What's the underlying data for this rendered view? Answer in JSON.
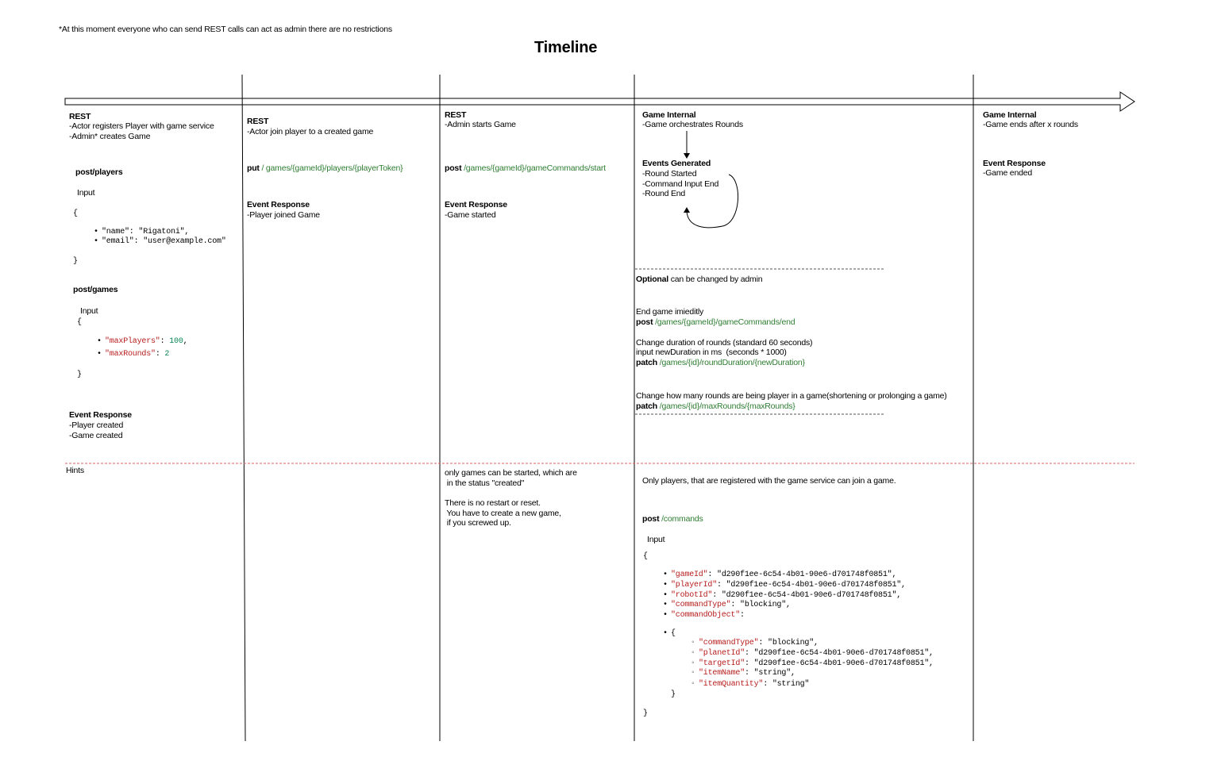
{
  "note": "*At this moment everyone who can send REST calls can act as admin there are no restrictions",
  "title": "Timeline",
  "col1": {
    "head": "REST",
    "l1": "-Actor registers Player with game service",
    "l2": "-Admin* creates Game",
    "ep1": "post/players",
    "input": "Input",
    "brace_open": "{",
    "brace_close": "}",
    "name_line": "\"name\": \"Rigatoni\",",
    "email_line": "\"email\": \"user@example.com\"",
    "ep2": "post/games",
    "k1": "\"maxPlayers\"",
    "v1": "100",
    "k2": "\"maxRounds\"",
    "v2": "2",
    "sep": ": ",
    "comma": ",",
    "er_head": "Event Response",
    "er1": "-Player created",
    "er2": "-Game created",
    "hints": "Hints"
  },
  "col2": {
    "head": "REST",
    "l1": "-Actor join player to a created game",
    "verb": "put",
    "path": " / games/{gameId}/players/{playerToken}",
    "er_head": "Event Response",
    "er1": "-Player joined Game"
  },
  "col3": {
    "head": "REST",
    "l1": "-Admin starts Game",
    "verb": "post",
    "path": " /games/{gameId}/gameCommands/start",
    "er_head": "Event Response",
    "er1": "-Game started",
    "h1": "only games can be started, which are",
    "h2": " in the status \"created\"",
    "h3": "There is no restart or reset.",
    "h4": " You have to create a new game,",
    "h5": " if you screwed up."
  },
  "col4": {
    "head": "Game Internal",
    "l1": "-Game orchestrates Rounds",
    "ev_head": "Events Generated",
    "ev1": "-Round Started",
    "ev2": "-Command Input End",
    "ev3": "-Round End",
    "opt_b": "Optional",
    "opt_t": " can be changed by admin",
    "end1": "End game imieditly",
    "end_verb": "post",
    "end_path": " /games/{gameId}/gameCommands/end",
    "dur1": "Change duration of rounds (standard 60 seconds)",
    "dur2": "input newDuration in ms  (seconds * 1000)",
    "dur_verb": "patch",
    "dur_path": " /games/{id}/roundDuration/{newDuration}",
    "mr1": "Change how many rounds are being player in a game(shortening or prolonging a game)",
    "mr_verb": "patch",
    "mr_path": " /games/{id}/maxRounds/{maxRounds}",
    "hint": "Only players, that are registered with the game service can join a game.",
    "cmd_verb": "post",
    "cmd_path": " /commands",
    "input": "Input",
    "brace_open": "{",
    "brace_close": "}",
    "f1k": "\"gameId\"",
    "f1v": ": \"d290f1ee-6c54-4b01-90e6-d701748f0851\",",
    "f2k": "\"playerId\"",
    "f2v": ": \"d290f1ee-6c54-4b01-90e6-d701748f0851\",",
    "f3k": "\"robotId\"",
    "f3v": ": \"d290f1ee-6c54-4b01-90e6-d701748f0851\",",
    "f4k": "\"commandType\"",
    "f4v": ": \"blocking\",",
    "f5k": "\"commandObject\"",
    "f5v": ":",
    "obj_open": "{",
    "obj_close": "}",
    "s1k": "\"commandType\"",
    "s1v": ": \"blocking\",",
    "s2k": "\"planetId\"",
    "s2v": ": \"d290f1ee-6c54-4b01-90e6-d701748f0851\",",
    "s3k": "\"targetId\"",
    "s3v": ": \"d290f1ee-6c54-4b01-90e6-d701748f0851\",",
    "s4k": "\"itemName\"",
    "s4v": ": \"string\",",
    "s5k": "\"itemQuantity\"",
    "s5v": ": \"string\""
  },
  "col5": {
    "head": "Game Internal",
    "l1": "-Game ends after x rounds",
    "er_head": "Event Response",
    "er1": "-Game ended"
  }
}
